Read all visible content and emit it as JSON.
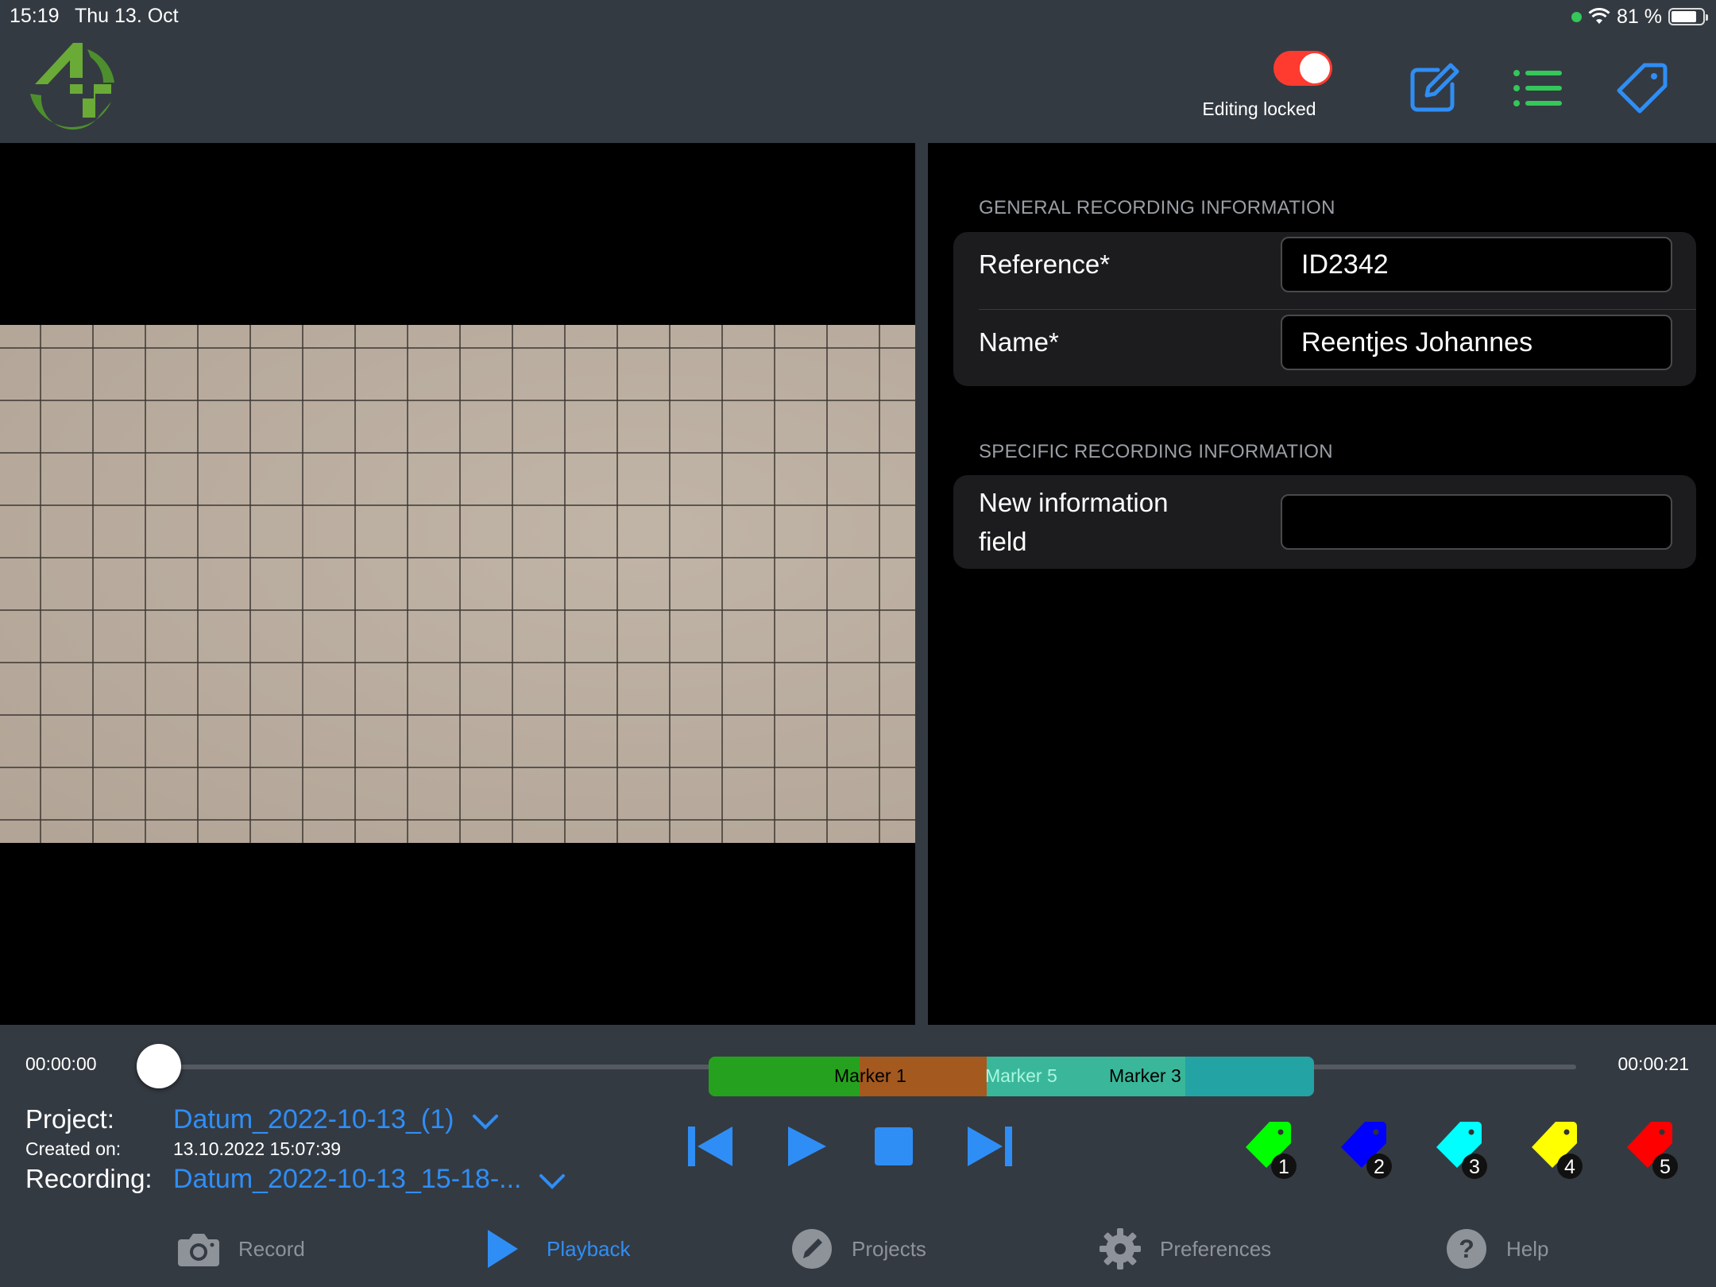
{
  "status_bar": {
    "time": "15:19",
    "date": "Thu 13. Oct",
    "battery": "81 %",
    "battery_level": 0.81
  },
  "header": {
    "editing_lock_label": "Editing locked",
    "editing_lock_on": true,
    "icons": [
      "edit-icon",
      "list-icon",
      "tag-icon"
    ]
  },
  "general_section": {
    "title": "GENERAL RECORDING INFORMATION",
    "rows": [
      {
        "label": "Reference*",
        "value": "ID2342"
      },
      {
        "label": "Name*",
        "value": "Reentjes Johannes"
      }
    ]
  },
  "specific_section": {
    "title": "SPECIFIC RECORDING INFORMATION",
    "rows": [
      {
        "label_line1": "New information",
        "label_line2": "field",
        "value": ""
      }
    ]
  },
  "timeline": {
    "start": "00:00:00",
    "end": "00:00:21",
    "markers": [
      {
        "label": "Marker 1",
        "color": "#26a11f"
      },
      {
        "label": "Marker 5",
        "color": "#5fd3b3"
      },
      {
        "label": "Marker 3",
        "color": "#23a3a3"
      }
    ],
    "position": 0
  },
  "meta": {
    "project_label": "Project:",
    "project_value": "Datum_2022-10-13_(1)",
    "created_label": "Created on:",
    "created_value": "13.10.2022 15:07:39",
    "recording_label": "Recording:",
    "recording_value": "Datum_2022-10-13_15-18-..."
  },
  "transport": [
    "skip-back-icon",
    "play-icon",
    "stop-icon",
    "skip-forward-icon"
  ],
  "marker_tags": [
    {
      "number": "1",
      "color": "#00ff00"
    },
    {
      "number": "2",
      "color": "#0000ff"
    },
    {
      "number": "3",
      "color": "#00ffff"
    },
    {
      "number": "4",
      "color": "#ffff00"
    },
    {
      "number": "5",
      "color": "#ff0000"
    }
  ],
  "tabs": [
    {
      "label": "Record",
      "icon": "camera-icon",
      "active": false
    },
    {
      "label": "Playback",
      "icon": "play-icon",
      "active": true
    },
    {
      "label": "Projects",
      "icon": "pencil-icon",
      "active": false
    },
    {
      "label": "Preferences",
      "icon": "gear-icon",
      "active": false
    },
    {
      "label": "Help",
      "icon": "help-icon",
      "active": false
    }
  ],
  "colors": {
    "accent": "#2f8ef5",
    "toggle_on": "#ff3b30",
    "list_icon": "#34c759"
  }
}
